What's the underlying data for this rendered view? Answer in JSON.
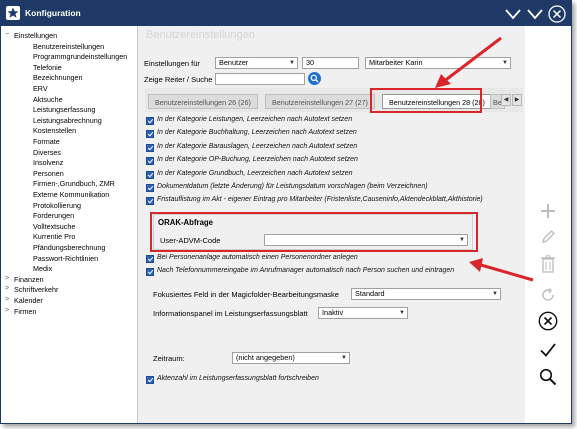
{
  "window": {
    "title": "Konfiguration"
  },
  "tree": {
    "items": [
      {
        "label": "Einstellungen",
        "level": 0,
        "expander": "−"
      },
      {
        "label": "Benutzereinstellungen",
        "level": 1
      },
      {
        "label": "Programmgrundeinstellungen",
        "level": 1
      },
      {
        "label": "Telefonie",
        "level": 1
      },
      {
        "label": "Bezeichnungen",
        "level": 1
      },
      {
        "label": "ERV",
        "level": 1
      },
      {
        "label": "Aktsuche",
        "level": 1
      },
      {
        "label": "Leistungserfassung",
        "level": 1
      },
      {
        "label": "Leistungsabrechnung",
        "level": 1
      },
      {
        "label": "Kostenstellen",
        "level": 1
      },
      {
        "label": "Formate",
        "level": 1
      },
      {
        "label": "Diverses",
        "level": 1
      },
      {
        "label": "Insolvenz",
        "level": 1
      },
      {
        "label": "Personen",
        "level": 1
      },
      {
        "label": "Firmen-,Grundbuch, ZMR",
        "level": 1
      },
      {
        "label": "Externe Kommunikation",
        "level": 1
      },
      {
        "label": "Protokollierung",
        "level": 1
      },
      {
        "label": "Forderungen",
        "level": 1
      },
      {
        "label": "Volltextsuche",
        "level": 1
      },
      {
        "label": "Kurrentie Pro",
        "level": 1
      },
      {
        "label": "Pfändungsberechnung",
        "level": 1
      },
      {
        "label": "Passwort-Richtlinien",
        "level": 1
      },
      {
        "label": "Medix",
        "level": 1
      },
      {
        "label": "Finanzen",
        "level": 0,
        "expander": ">"
      },
      {
        "label": "Schriftverkehr",
        "level": 0,
        "expander": ">"
      },
      {
        "label": "Kalender",
        "level": 0,
        "expander": ">"
      },
      {
        "label": "Firmen",
        "level": 0,
        "expander": ">"
      }
    ]
  },
  "content": {
    "ghost_title": "Benutzereinstellungen",
    "settings_for_label": "Einstellungen für",
    "settings_for_value": "Benutzer",
    "user_number": "30",
    "user_name": "Mitarbeiter Karin",
    "search_label": "Zeige Reiter / Suche",
    "search_value": "",
    "tabs": [
      {
        "label": "Benutzereinstellungen 26 (26)"
      },
      {
        "label": "Benutzereinstellungen 27 (27)"
      },
      {
        "label": "Benutzereinstellungen 28 (28)"
      },
      {
        "label": "Be"
      }
    ],
    "checkboxes_top": [
      "In der Kategorie Leistungen, Leerzeichen nach Autotext setzen",
      "In der Kategorie Buchhaltung, Leerzeichen nach Autotext setzen",
      "In der Kategorie Barauslagen, Leerzeichen nach Autotext setzen",
      "In der Kategorie OP-Buchung, Leerzeichen nach Autotext setzen",
      "In der Kategorie Grundbuch, Leerzeichen nach Autotext setzen",
      "Dokumentdatum (letzte Änderung) für Leistungsdatum vorschlagen (beim Verzeichnen)",
      "Fristauflistung im Akt - eigener Eintrag pro Mitarbeiter (Fristenliste,Causeninfo,Aktendeckblatt,Akthistorie)"
    ],
    "orak_title": "ORAK-Abfrage",
    "orak_field_label": "User-ADVM-Code",
    "orak_field_value": "",
    "checkboxes_mid": [
      "Bei Personenanlage automatisch einen Personenordner anlegen",
      "Nach Telefonnummereingabe im Anrufmanager automatisch nach Person suchen und eintragen"
    ],
    "magic_label": "Fokusiertes Feld in der Magicfolder-Bearbeitungsmaske",
    "magic_value": "Standard",
    "info_label": "Informationspanel im Leistungserfassungsblatt",
    "info_value": "Inaktiv",
    "zeitraum_label": "Zeitraum:",
    "zeitraum_value": "(nicht angegeben)",
    "aktenzahl_label": "Aktenzahl im Leistungserfassungsblatt fortschreiben"
  },
  "icons": {
    "toolbar": [
      "plus-icon",
      "pencil-icon",
      "trash-icon",
      "refresh-icon",
      "cancel-circle-icon",
      "checkmark-icon",
      "search-icon"
    ]
  },
  "colors": {
    "titlebar": "#1f3a66",
    "accent": "#2a62b8",
    "highlight": "#d9262c"
  }
}
